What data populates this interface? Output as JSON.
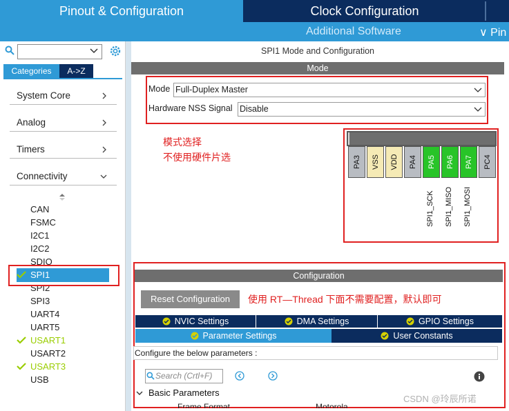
{
  "top_tabs": {
    "pinout": "Pinout & Configuration",
    "clock": "Clock Configuration"
  },
  "sub_tabs": {
    "additional": "Additional Software",
    "pinout_partial": "∨ Pin"
  },
  "left": {
    "tab_categories": "Categories",
    "tab_az": "A->Z",
    "categories": [
      "System Core",
      "Analog",
      "Timers",
      "Connectivity"
    ],
    "connectivity_items": [
      {
        "label": "CAN",
        "checked": false
      },
      {
        "label": "FSMC",
        "checked": false
      },
      {
        "label": "I2C1",
        "checked": false
      },
      {
        "label": "I2C2",
        "checked": false
      },
      {
        "label": "SDIO",
        "checked": false
      },
      {
        "label": "SPI1",
        "checked": true,
        "selected": true
      },
      {
        "label": "SPI2",
        "checked": false
      },
      {
        "label": "SPI3",
        "checked": false
      },
      {
        "label": "UART4",
        "checked": false
      },
      {
        "label": "UART5",
        "checked": false
      },
      {
        "label": "USART1",
        "checked": true
      },
      {
        "label": "USART2",
        "checked": false
      },
      {
        "label": "USART3",
        "checked": true
      },
      {
        "label": "USB",
        "checked": false
      }
    ]
  },
  "main": {
    "title": "SPI1 Mode and Configuration",
    "mode_header": "Mode",
    "mode_label": "Mode",
    "mode_value": "Full-Duplex Master",
    "nss_label": "Hardware NSS Signal",
    "nss_value": "Disable",
    "annotation_mode_line1": "模式选择",
    "annotation_mode_line2": "不使用硬件片选",
    "pins": [
      {
        "label": "PA3",
        "kind": "gray"
      },
      {
        "label": "VSS",
        "kind": "yellow"
      },
      {
        "label": "VDD",
        "kind": "yellow"
      },
      {
        "label": "PA4",
        "kind": "gray"
      },
      {
        "label": "PA5",
        "kind": "green"
      },
      {
        "label": "PA6",
        "kind": "green"
      },
      {
        "label": "PA7",
        "kind": "green"
      },
      {
        "label": "PC4",
        "kind": "gray"
      }
    ],
    "pin_signals": [
      "SPI1_SCK",
      "SPI1_MISO",
      "SPI1_MOSI"
    ],
    "config_header": "Configuration",
    "reset_button": "Reset Configuration",
    "annotation_config": "使用 RT—Thread 下面不需要配置，默认即可",
    "tabs_row1": [
      "NVIC Settings",
      "DMA Settings",
      "GPIO Settings"
    ],
    "tabs_row2": [
      "Parameter Settings",
      "User Constants"
    ],
    "configure_text": "Configure the below parameters :",
    "search_placeholder": "Search (Crtl+F)",
    "basic_parameters": "Basic Parameters",
    "row_label_cut": "Frame Format",
    "row_value_cut": "Motorola",
    "watermark": "CSDN @玲辰所诺"
  },
  "colors": {
    "accent_blue": "#2f9ad6",
    "navy": "#0b2c5e",
    "annotation_red": "#e02020",
    "pin_green": "#28c428",
    "check_green": "#9acd00"
  }
}
